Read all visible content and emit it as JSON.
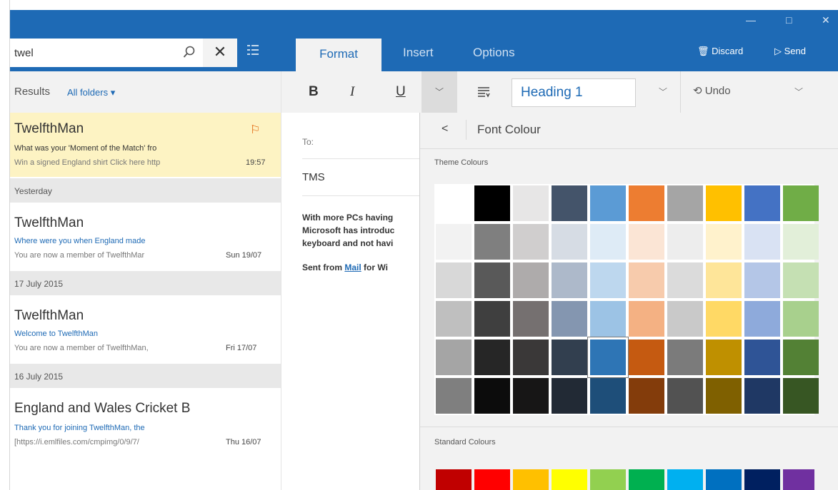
{
  "window": {
    "minimize_glyph": "—",
    "maximize_glyph": "□",
    "close_glyph": "✕"
  },
  "search": {
    "value": "twel",
    "icon": "search-icon",
    "clear_glyph": "✕"
  },
  "ribbon": {
    "tabs": [
      "Format",
      "Insert",
      "Options"
    ],
    "active_tab": "Format",
    "discard_label": "Discard",
    "send_label": "Send",
    "accent_color": "#1e6ab5"
  },
  "toolbar": {
    "bold": "B",
    "italic": "I",
    "underline": "U",
    "style_value": "Heading 1",
    "undo_label": "Undo"
  },
  "list": {
    "results_label": "Results",
    "folder_filter": "All folders ▾",
    "messages": [
      {
        "sender": "TwelfthMan",
        "subject": "What was your 'Moment of the Match' fro",
        "preview": "Win a signed England shirt Click here http",
        "date": "19:57",
        "flagged": true
      },
      {
        "sender": "TwelfthMan",
        "subject": "Where were you when England made",
        "preview": "You are now a member of TwelfthMar",
        "date": "Sun 19/07"
      },
      {
        "sender": "TwelfthMan",
        "subject": "Welcome to TwelfthMan",
        "preview": "You are now a member of TwelfthMan,",
        "date": "Fri 17/07"
      },
      {
        "sender": "England and Wales Cricket B",
        "subject": "Thank you for joining TwelfthMan, the",
        "preview": "[https://i.emlfiles.com/cmpimg/0/9/7/",
        "date": "Thu 16/07"
      }
    ],
    "groups": [
      "Yesterday",
      "17 July 2015",
      "16 July 2015"
    ]
  },
  "compose": {
    "to_label": "To:",
    "subject": "TMS",
    "body_lines": [
      "With more PCs having",
      "Microsoft has introduc",
      "keyboard and not havi"
    ],
    "signature_prefix": "Sent from ",
    "signature_link": "Mail",
    "signature_suffix": " for Wi"
  },
  "flyout": {
    "back_glyph": "<",
    "title": "Font Colour",
    "theme_label": "Theme Colours",
    "standard_label": "Standard Colours",
    "selected_swatch": "row5-col5",
    "theme_colors": [
      [
        "#ffffff",
        "#000000",
        "#e7e6e6",
        "#44546a",
        "#5b9bd5",
        "#ed7d31",
        "#a5a5a5",
        "#ffc000",
        "#4472c4",
        "#70ad47"
      ],
      [
        "#f2f2f2",
        "#7f7f7f",
        "#d0cece",
        "#d6dce4",
        "#deebf6",
        "#fbe5d5",
        "#ededed",
        "#fff2cc",
        "#d9e2f3",
        "#e2efd9"
      ],
      [
        "#d8d8d8",
        "#595959",
        "#aeabab",
        "#adb9ca",
        "#bdd7ee",
        "#f7cbac",
        "#dbdbdb",
        "#fee599",
        "#b4c6e7",
        "#c5e0b3"
      ],
      [
        "#bfbfbf",
        "#3f3f3f",
        "#757070",
        "#8496b0",
        "#9cc3e5",
        "#f4b183",
        "#c9c9c9",
        "#ffd965",
        "#8eaadb",
        "#a8d08d"
      ],
      [
        "#a5a5a5",
        "#262626",
        "#3a3838",
        "#323f4f",
        "#2e75b5",
        "#c55a11",
        "#7b7b7b",
        "#bf9000",
        "#2f5496",
        "#538135"
      ],
      [
        "#7f7f7f",
        "#0c0c0c",
        "#171616",
        "#222a35",
        "#1e4e79",
        "#833c0b",
        "#525252",
        "#7f6000",
        "#1f3864",
        "#375623"
      ]
    ],
    "standard_colors": [
      "#c00000",
      "#ff0000",
      "#ffc000",
      "#ffff00",
      "#92d050",
      "#00b050",
      "#00b0f0",
      "#0070c0",
      "#002060",
      "#7030a0"
    ]
  }
}
